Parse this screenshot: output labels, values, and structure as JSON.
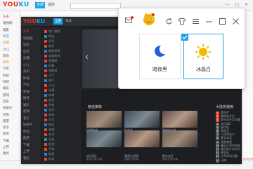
{
  "outer_app": {
    "logo_part1": "YOU",
    "logo_part2": "KU",
    "tab_active": "全部",
    "tab_2": "播放",
    "window_buttons": "— □ ✕",
    "sidebar": [
      "头条",
      "电视剧",
      "电影",
      "综艺",
      "动漫",
      "少儿",
      "资讯",
      "体育",
      "汽车",
      "科技",
      "财经",
      "娱乐",
      "游戏",
      "音乐",
      "纪录片",
      "时尚",
      "旅游",
      "亲子",
      "搞笑",
      "下载",
      "上传",
      "我的"
    ],
    "bottom_text": ""
  },
  "inner_app": {
    "logo_part1": "YOU",
    "logo_part2": "KU",
    "tab_active": "全部",
    "tab_2": "播放",
    "sidebar": [
      "头条",
      "电视剧",
      "电影",
      "综艺",
      "动漫",
      "少儿",
      "资讯",
      "体育",
      "汽车",
      "科技",
      "财经",
      "娱乐",
      "游戏",
      "音乐",
      "纪录片",
      "时尚",
      "旅游",
      "下载",
      "上传",
      "我的"
    ],
    "list_items": [
      "热门推荐",
      "精选",
      "资讯",
      "娱乐",
      "最新更新",
      "追剧时间",
      "热播榜",
      "好看",
      "电影榜",
      "人气",
      "热门",
      "少儿",
      "动漫",
      "体育",
      "综艺",
      "科技",
      "音乐",
      "游戏",
      "生活",
      "搞笑",
      "旅游",
      "亲子",
      "纪录",
      "原创",
      "汽车",
      "财经",
      "时尚"
    ],
    "recommend_heading": "精选推荐",
    "hotlist_heading": "大陆热播榜",
    "thumb_captions": [
      "极限挑战",
      "好先生",
      "我的前半生",
      "欢乐颂2",
      "我是大侦探",
      "那年花开",
      "楚乔传",
      "琅琊榜"
    ],
    "thumb_subs": [
      "更新至第10期",
      "更新至第42集",
      "更新至第42集",
      "更新至第55集",
      "更新至第8期",
      "更新至第60集",
      "更新至第58集",
      "全54集"
    ],
    "hot_rows": [
      "楚乔传",
      "我的前半生",
      "那年花开月正圆",
      "欢乐颂2",
      "醉玲珑",
      "择天记",
      "人民的名义",
      "夏至未至",
      "深夜食堂",
      "春风十里不如你",
      "我们的少年时代",
      "寒武纪",
      "大军师司马懿",
      "河神",
      "幻城"
    ]
  },
  "popup": {
    "theme_dark_label": "暗夜黑",
    "theme_light_label": "冰晶白",
    "icons": [
      "mail-icon",
      "avatar-mascot",
      "refresh-icon",
      "shirt-icon",
      "menu-icon",
      "minimize-icon",
      "maximize-icon",
      "close-icon",
      "check-icon",
      "moon-icon",
      "sun-icon"
    ],
    "accent": "#1fa0e8",
    "moon_color": "#2060d8",
    "sun_color": "#f5b800",
    "selected_theme": "冰晶白"
  }
}
